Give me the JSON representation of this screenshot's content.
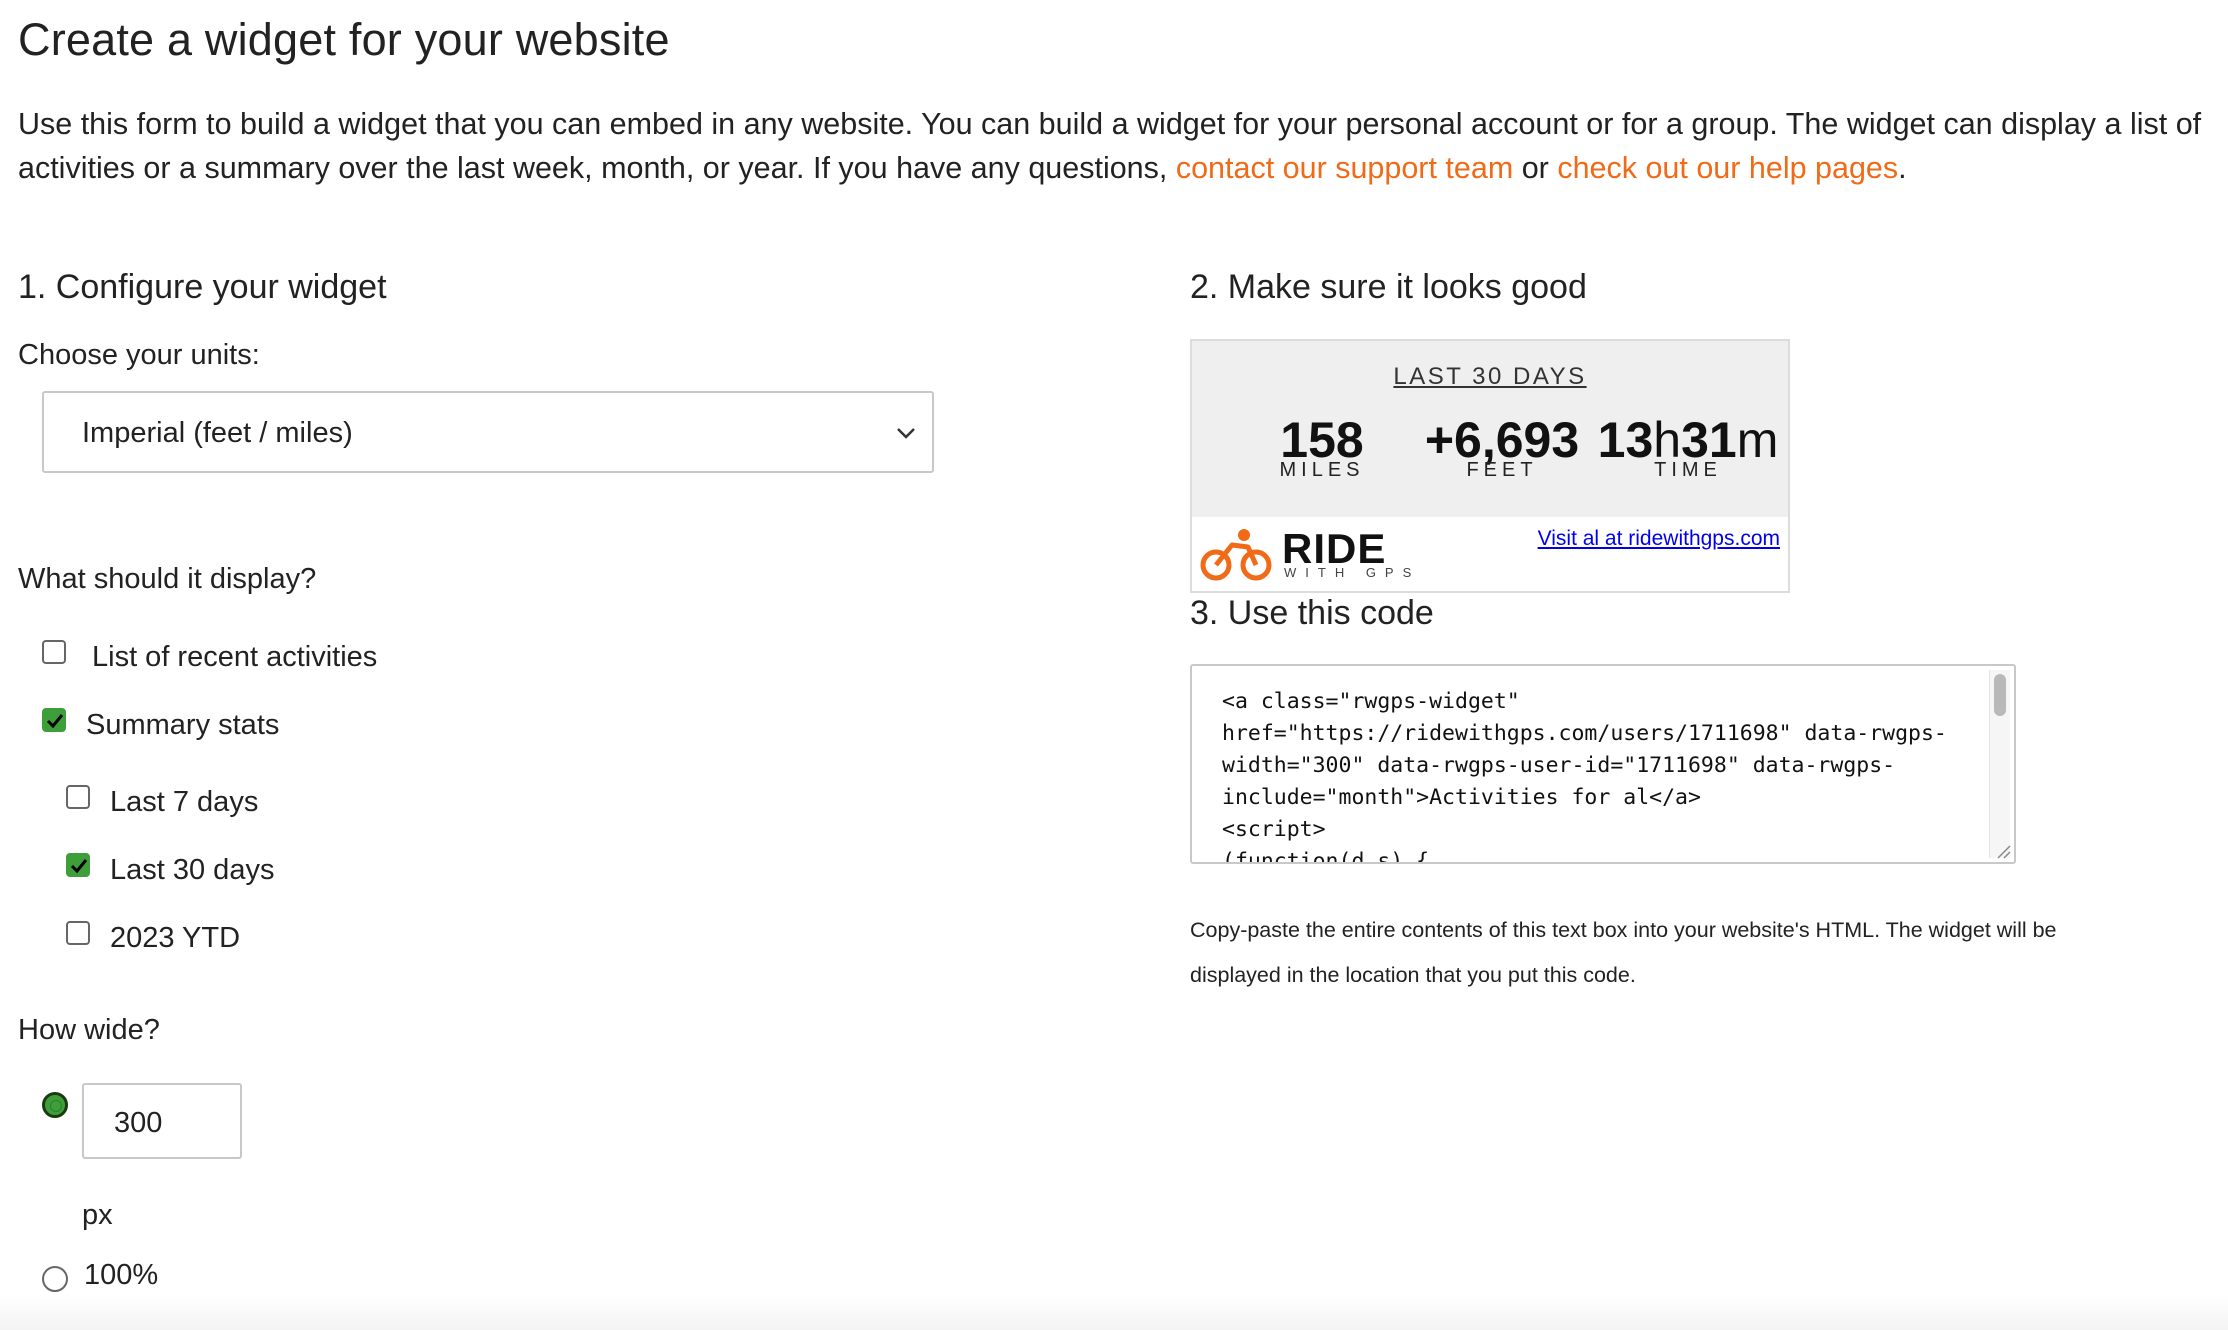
{
  "header": {
    "title": "Create a widget for your website",
    "intro_text": "Use this form to build a widget that you can embed in any website. You can build a widget for your personal account or for a group. The widget can display a list of activities or a summary over the last week, month, or year. If you have any questions, ",
    "support_link": "contact our support team",
    "intro_or": " or ",
    "help_link": "check out our help pages",
    "intro_end": ".",
    "link_color": "#f06a17"
  },
  "configure": {
    "heading": "1. Configure your widget",
    "units_label": "Choose your units:",
    "units_selected": "Imperial (feet / miles)",
    "display_label": "What should it display?",
    "options": [
      {
        "label": "List of recent activities",
        "checked": false
      },
      {
        "label": "Summary stats",
        "checked": true
      }
    ],
    "ranges": [
      {
        "label": "Last 7 days",
        "checked": false
      },
      {
        "label": "Last 30 days",
        "checked": true
      },
      {
        "label": "2023 YTD",
        "checked": false
      }
    ],
    "width_label": "How wide?",
    "width_value": "300",
    "width_unit": "px",
    "full_width_label": "100%",
    "accent_color": "#3e9f3a"
  },
  "preview": {
    "heading": "2. Make sure it looks good",
    "range_title": "LAST 30 DAYS",
    "stats": [
      {
        "value": "158",
        "label": "MILES"
      },
      {
        "value": "+6,693",
        "label": "FEET"
      },
      {
        "hours": "13",
        "h": "h",
        "minutes": "31",
        "m": "m",
        "label": "TIME"
      }
    ],
    "logo_text": "RIDE",
    "logo_sub": "WITH GPS",
    "visit_link": "Visit al at ridewithgps.com",
    "logo_color": "#f06a17"
  },
  "code": {
    "heading": "3. Use this code",
    "snippet": "<a class=\"rwgps-widget\" href=\"https://ridewithgps.com/users/1711698\" data-rwgps-width=\"300\" data-rwgps-user-id=\"1711698\" data-rwgps-include=\"month\">Activities for al</a>\n<script>\n(function(d,s) {",
    "note": "Copy-paste the entire contents of this text box into your website's HTML. The widget will be displayed in the location that you put this code."
  }
}
